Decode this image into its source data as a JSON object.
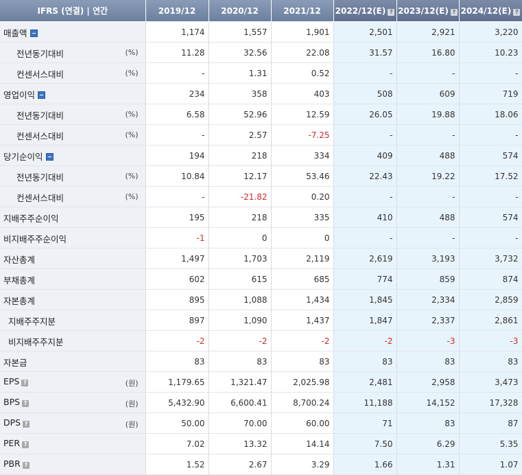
{
  "header": {
    "label_col": "IFRS (연결) | 연간",
    "periods": [
      "2019/12",
      "2020/12",
      "2021/12",
      "2022/12(E)",
      "2023/12(E)",
      "2024/12(E)"
    ]
  },
  "rows": [
    {
      "label": "매출액",
      "unit": "",
      "values": [
        "1,174",
        "1,557",
        "1,901",
        "2,501",
        "2,921",
        "3,220"
      ]
    },
    {
      "label": "전년동기대비",
      "unit": "(%)",
      "values": [
        "11.28",
        "32.56",
        "22.08",
        "31.57",
        "16.80",
        "10.23"
      ]
    },
    {
      "label": "컨센서스대비",
      "unit": "(%)",
      "values": [
        "-",
        "1.31",
        "0.52",
        "-",
        "-",
        "-"
      ]
    },
    {
      "label": "영업이익",
      "unit": "",
      "values": [
        "234",
        "358",
        "403",
        "508",
        "609",
        "719"
      ]
    },
    {
      "label": "전년동기대비",
      "unit": "(%)",
      "values": [
        "6.58",
        "52.96",
        "12.59",
        "26.05",
        "19.88",
        "18.06"
      ]
    },
    {
      "label": "컨센서스대비",
      "unit": "(%)",
      "values": [
        "-",
        "2.57",
        "-7.25",
        "-",
        "-",
        "-"
      ]
    },
    {
      "label": "당기순이익",
      "unit": "",
      "values": [
        "194",
        "218",
        "334",
        "409",
        "488",
        "574"
      ]
    },
    {
      "label": "전년동기대비",
      "unit": "(%)",
      "values": [
        "10.84",
        "12.17",
        "53.46",
        "22.43",
        "19.22",
        "17.52"
      ]
    },
    {
      "label": "컨센서스대비",
      "unit": "(%)",
      "values": [
        "-",
        "-21.82",
        "0.20",
        "-",
        "-",
        "-"
      ]
    },
    {
      "label": "지배주주순이익",
      "unit": "",
      "values": [
        "195",
        "218",
        "335",
        "410",
        "488",
        "574"
      ]
    },
    {
      "label": "비지배주주순이익",
      "unit": "",
      "values": [
        "-1",
        "0",
        "0",
        "-",
        "-",
        "-"
      ]
    },
    {
      "label": "자산총계",
      "unit": "",
      "values": [
        "1,497",
        "1,703",
        "2,119",
        "2,619",
        "3,193",
        "3,732"
      ]
    },
    {
      "label": "부채총계",
      "unit": "",
      "values": [
        "602",
        "615",
        "685",
        "774",
        "859",
        "874"
      ]
    },
    {
      "label": "자본총계",
      "unit": "",
      "values": [
        "895",
        "1,088",
        "1,434",
        "1,845",
        "2,334",
        "2,859"
      ]
    },
    {
      "label": "지배주주지분",
      "unit": "",
      "values": [
        "897",
        "1,090",
        "1,437",
        "1,847",
        "2,337",
        "2,861"
      ]
    },
    {
      "label": "비지배주주지분",
      "unit": "",
      "values": [
        "-2",
        "-2",
        "-2",
        "-2",
        "-3",
        "-3"
      ]
    },
    {
      "label": "자본금",
      "unit": "",
      "values": [
        "83",
        "83",
        "83",
        "83",
        "83",
        "83"
      ]
    },
    {
      "label": "EPS",
      "unit": "(원)",
      "values": [
        "1,179.65",
        "1,321.47",
        "2,025.98",
        "2,481",
        "2,958",
        "3,473"
      ]
    },
    {
      "label": "BPS",
      "unit": "(원)",
      "values": [
        "5,432.90",
        "6,600.41",
        "8,700.24",
        "11,188",
        "14,152",
        "17,328"
      ]
    },
    {
      "label": "DPS",
      "unit": "(원)",
      "values": [
        "50.00",
        "70.00",
        "60.00",
        "71",
        "83",
        "87"
      ]
    },
    {
      "label": "PER",
      "unit": "",
      "values": [
        "7.02",
        "13.32",
        "14.14",
        "7.50",
        "6.29",
        "5.35"
      ]
    },
    {
      "label": "PBR",
      "unit": "",
      "values": [
        "1.52",
        "2.67",
        "3.29",
        "1.66",
        "1.31",
        "1.07"
      ]
    }
  ],
  "icons": {
    "collapse": "minus-icon",
    "help": "help-icon"
  },
  "colors": {
    "header_bg": "#7a8cab",
    "estimate_bg": "#e8f4fb",
    "label_bg": "#eef1f5",
    "negative": "#d0292c"
  }
}
